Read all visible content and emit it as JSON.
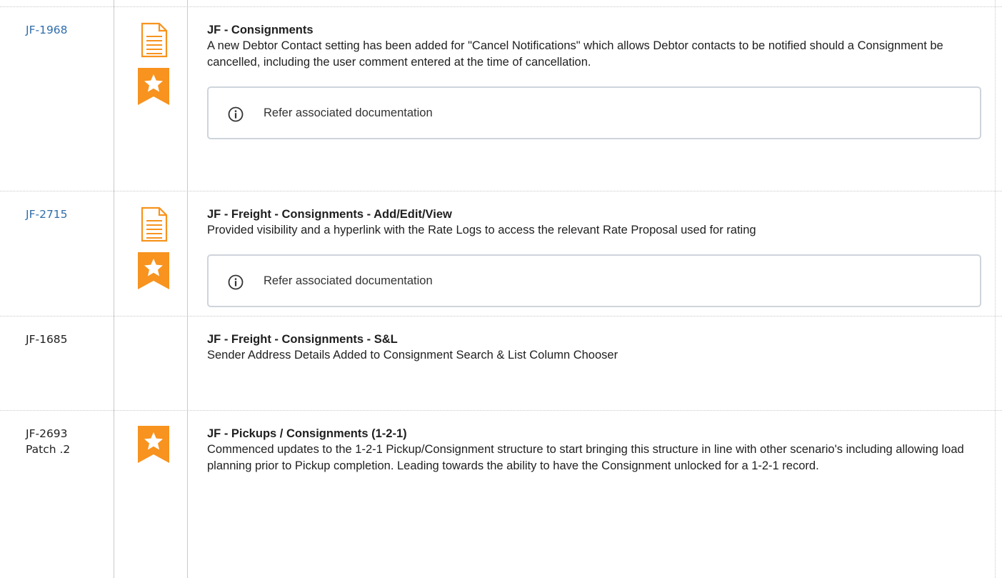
{
  "rows": [
    {
      "key": "JF-1968",
      "key_is_link": true,
      "title": "JF - Consignments",
      "description": "A new Debtor Contact setting has been added for \"Cancel Notifications\" which allows Debtor contacts to be notified should a Consignment be cancelled, including the user comment entered at the time of cancellation.",
      "panel_text": "Refer associated documentation",
      "icons": [
        "document-icon",
        "star-icon"
      ]
    },
    {
      "key": "JF-2715",
      "key_is_link": true,
      "title": "JF - Freight - Consignments - Add/Edit/View",
      "description": "Provided visibility and a hyperlink with the Rate Logs to access the relevant Rate Proposal used for rating",
      "panel_text": "Refer associated documentation",
      "icons": [
        "document-icon",
        "star-icon"
      ]
    },
    {
      "key": "JF-1685",
      "key_is_link": false,
      "title": "JF - Freight - Consignments - S&L",
      "description": "Sender Address Details Added to Consignment Search & List Column Chooser",
      "icons": []
    },
    {
      "key": "JF-2693",
      "key_sub": "Patch .2",
      "key_is_link": false,
      "title": "JF - Pickups / Consignments (1-2-1)",
      "description": "Commenced updates to the 1-2-1 Pickup/Consignment structure to start bringing this structure in line with other scenario's including allowing load planning prior to Pickup completion.  Leading towards the ability to have the Consignment unlocked for a 1-2-1 record.",
      "icons": [
        "star-icon"
      ]
    }
  ],
  "colors": {
    "link": "#2f6eab",
    "icon_orange": "#f7931e",
    "border": "#c9c9c9"
  }
}
